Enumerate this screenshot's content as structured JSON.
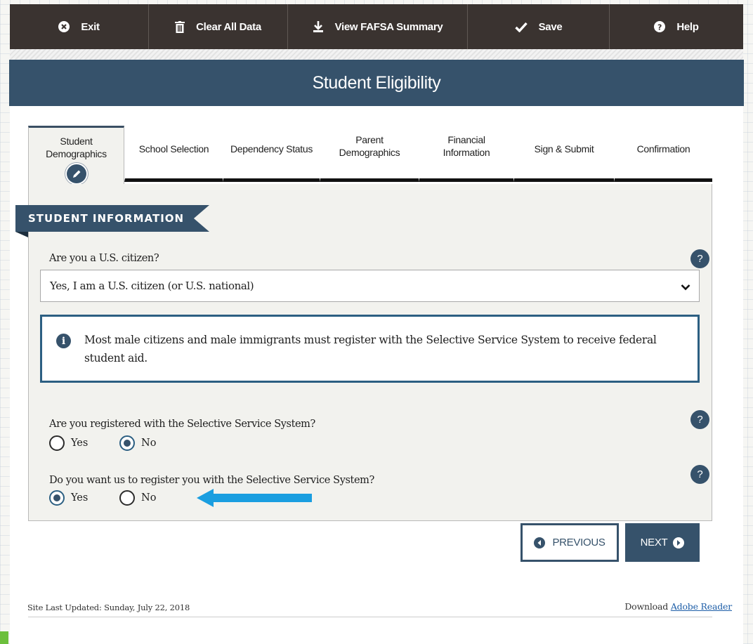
{
  "toolbar": {
    "exit_label": "Exit",
    "clear_label": "Clear All Data",
    "summary_label": "View FAFSA Summary",
    "save_label": "Save",
    "help_label": "Help"
  },
  "header": {
    "title": "Student Eligibility"
  },
  "tabs": [
    {
      "label": "Student Demographics",
      "active": true
    },
    {
      "label": "School Selection"
    },
    {
      "label": "Dependency Status"
    },
    {
      "label": "Parent Demographics"
    },
    {
      "label": "Financial Information"
    },
    {
      "label": "Sign & Submit"
    },
    {
      "label": "Confirmation"
    }
  ],
  "section": {
    "title": "STUDENT INFORMATION"
  },
  "citizenship": {
    "question": "Are you a U.S. citizen?",
    "selected": "Yes, I am a U.S. citizen (or U.S. national)"
  },
  "info": {
    "text": "Most male citizens and male immigrants must register with the Selective Service System to receive federal student aid."
  },
  "registered": {
    "question": "Are you registered with the Selective Service System?",
    "options": [
      "Yes",
      "No"
    ],
    "selected": "No"
  },
  "register_request": {
    "question": "Do you want us to register you with the Selective Service System?",
    "options": [
      "Yes",
      "No"
    ],
    "selected": "Yes"
  },
  "help_mark": "?",
  "info_mark": "i",
  "nav": {
    "previous_label": "PREVIOUS",
    "next_label": "NEXT"
  },
  "footer": {
    "updated": "Site Last Updated: Sunday, July 22, 2018",
    "download_prefix": "Download",
    "download_link": "Adobe Reader"
  },
  "colors": {
    "primary": "#36526b",
    "toolbar": "#3a3330",
    "annotation_arrow": "#1a9ee0"
  }
}
